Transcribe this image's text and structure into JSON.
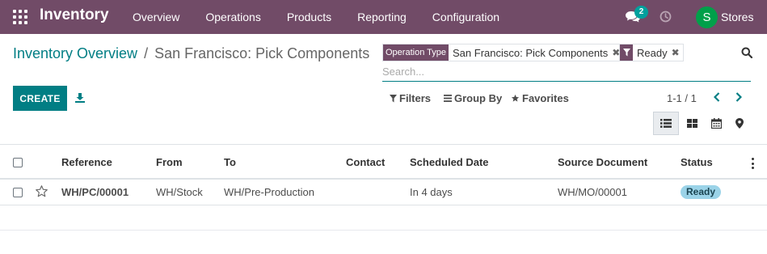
{
  "navbar": {
    "app_title": "Inventory",
    "menu": [
      "Overview",
      "Operations",
      "Products",
      "Reporting",
      "Configuration"
    ],
    "chat_count": "2",
    "avatar_letter": "S",
    "company": "Stores",
    "color": "#714b67"
  },
  "breadcrumb": {
    "parent": "Inventory Overview",
    "separator": "/",
    "current": "San Francisco: Pick Components"
  },
  "search": {
    "facets": [
      {
        "label": "Operation Type",
        "value": "San Francisco: Pick Components"
      },
      {
        "label": "filter-icon",
        "value": "Ready"
      }
    ],
    "placeholder": "Search..."
  },
  "toolbar": {
    "create_label": "CREATE",
    "filters_label": "Filters",
    "groupby_label": "Group By",
    "favorites_label": "Favorites",
    "pager": "1-1 / 1"
  },
  "views": [
    "list-icon",
    "kanban-icon",
    "calendar-icon",
    "map-pin-icon"
  ],
  "table": {
    "columns": [
      "Reference",
      "From",
      "To",
      "Contact",
      "Scheduled Date",
      "Source Document",
      "Status"
    ],
    "rows": [
      {
        "reference": "WH/PC/00001",
        "from": "WH/Stock",
        "to": "WH/Pre-Production",
        "contact": "",
        "scheduled_date": "In 4 days",
        "source_document": "WH/MO/00001",
        "status": "Ready"
      }
    ]
  },
  "colors": {
    "accent": "#017e84",
    "status_ready": "#9bd3e8"
  }
}
